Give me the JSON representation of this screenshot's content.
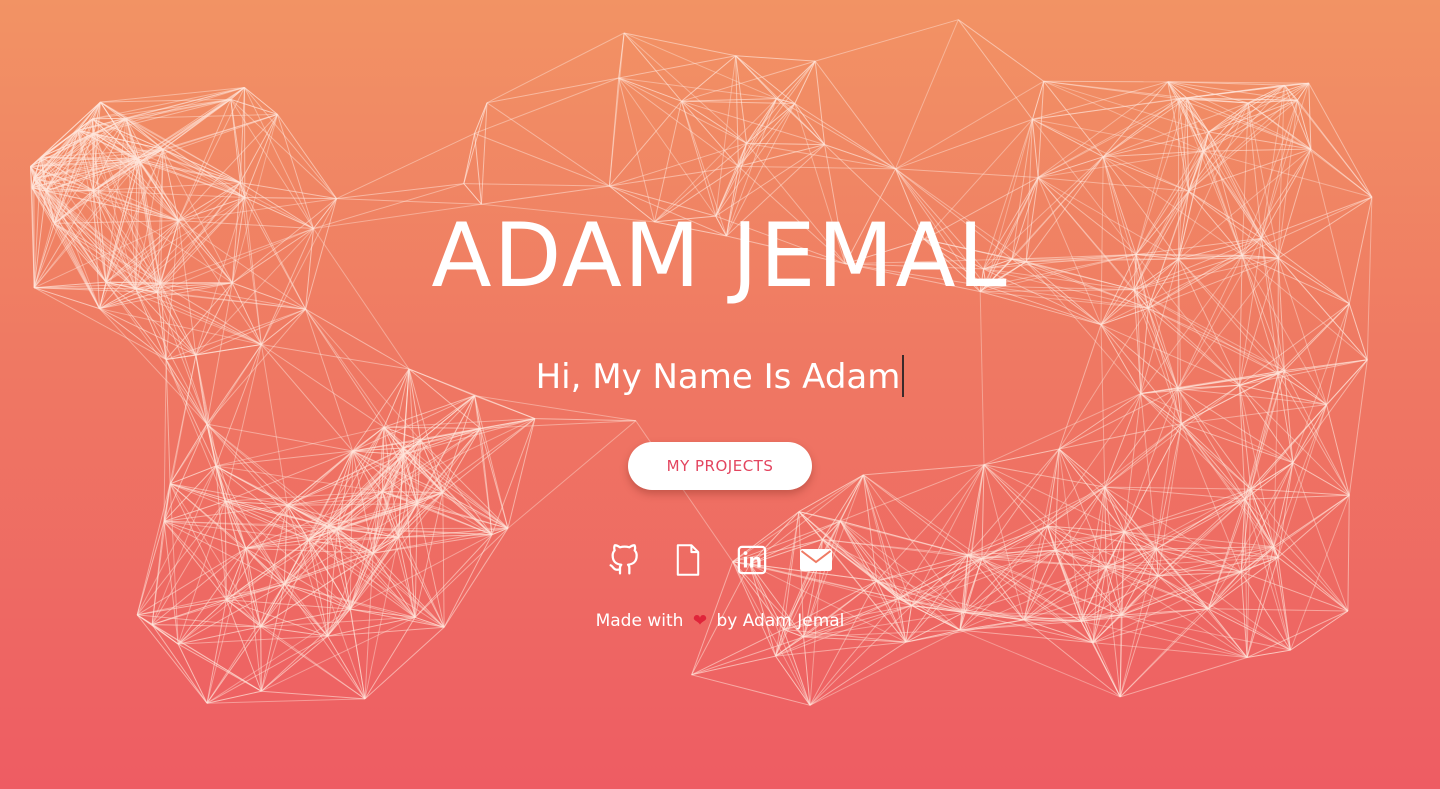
{
  "hero": {
    "title": "ADAM JEMAL",
    "typed_text": "Hi, My Name Is Adam"
  },
  "buttons": {
    "projects_label": "MY PROJECTS"
  },
  "social": {
    "icons": [
      "github-icon",
      "resume-file-icon",
      "linkedin-icon",
      "email-icon"
    ]
  },
  "footer": {
    "made_with": "Made with",
    "heart_glyph": "❤",
    "by_author": "by Adam Jemal"
  },
  "colors": {
    "gradient_top": "#f29364",
    "gradient_bottom": "#ee5c63",
    "button_text": "#e3455f",
    "heart": "#e0243a",
    "network_lines": "#ffe6dc"
  }
}
